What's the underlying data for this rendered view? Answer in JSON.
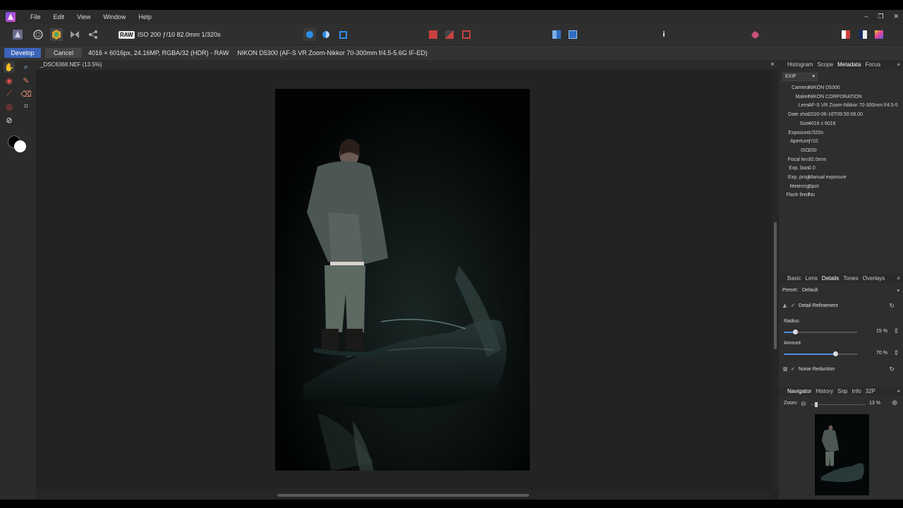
{
  "menu": {
    "items": [
      "File",
      "Edit",
      "View",
      "Window",
      "Help"
    ]
  },
  "window_controls": {
    "minimize": "‒",
    "restore": "❐",
    "close": "✕"
  },
  "toolbar": {
    "raw_badge": "RAW",
    "exif_summary": "ISO 200 ƒ/10 82.0mm 1/320s"
  },
  "context": {
    "develop_label": "Develop",
    "cancel_label": "Cancel",
    "image_info": "4016 × 6016px, 24.16MP, RGBA/32 (HDR) - RAW",
    "camera_info": "NIKON D5300 (AF-S VR Zoom-Nikkor 70-300mm f/4.5-5.6G IF-ED)"
  },
  "document": {
    "tab_title": "_DSC6368.NEF (13.5%)",
    "close_glyph": "×"
  },
  "metadata_panel": {
    "tabs": [
      "Histogram",
      "Scope",
      "Metadata",
      "Focus"
    ],
    "active_tab": "Metadata",
    "source": "EXIF",
    "rows": [
      {
        "key": "Camera",
        "value": "NIKON D5300"
      },
      {
        "key": "Maker",
        "value": "NIKON CORPORATION"
      },
      {
        "key": "Lens",
        "value": "AF-S VR Zoom-Nikkor 70-300mm f/4.5-5"
      },
      {
        "key": "Date shot",
        "value": "2020-06-16T09:50:06.00"
      },
      {
        "key": "Size",
        "value": "4016 x 6016"
      },
      {
        "key": "Exposure",
        "value": "1/320s"
      },
      {
        "key": "Aperture",
        "value": "ƒ/10"
      },
      {
        "key": "ISO",
        "value": "200"
      },
      {
        "key": "Focal len.",
        "value": "82.0mm"
      },
      {
        "key": "Exp. bias",
        "value": "0.0"
      },
      {
        "key": "Exp. prog",
        "value": "Manual exposure"
      },
      {
        "key": "Metering",
        "value": "Spot"
      },
      {
        "key": "Flash fired",
        "value": "No"
      }
    ]
  },
  "develop_panel": {
    "tabs": [
      "Basic",
      "Lens",
      "Details",
      "Tones",
      "Overlays"
    ],
    "active_tab": "Details",
    "preset_label": "Preset:",
    "preset_value": "Default",
    "detail_refinement": "Detail Refinement",
    "radius_label": "Radius",
    "radius_value": "15 %",
    "radius_fraction": 0.15,
    "amount_label": "Amount",
    "amount_value": "70 %",
    "amount_fraction": 0.7,
    "noise_reduction": "Noise Reduction"
  },
  "navigator_panel": {
    "tabs": [
      "Navigator",
      "History",
      "Snp",
      "Info",
      "32P"
    ],
    "active_tab": "Navigator",
    "zoom_label": "Zoom:",
    "zoom_value": "13 %"
  },
  "colors": {
    "accent": "#3c64b8",
    "slider_fill": "#4a8ee0"
  }
}
